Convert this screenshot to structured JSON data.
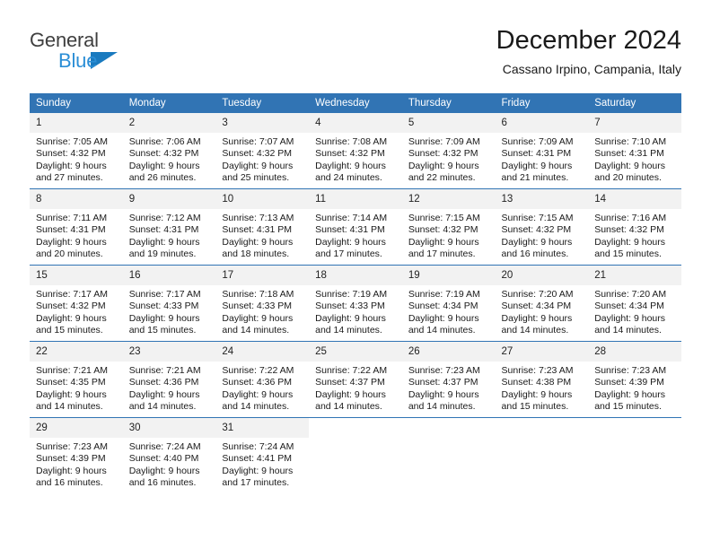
{
  "brand": {
    "name_part1": "General",
    "name_part2": "Blue",
    "triangle_icon": "blue-triangle-logo-mark"
  },
  "header": {
    "title": "December 2024",
    "subtitle": "Cassano Irpino, Campania, Italy"
  },
  "colors": {
    "header_blue": "#3174b4",
    "logo_blue": "#2b8ed6",
    "daynum_band": "#f2f2f2",
    "text": "#1a1a1a"
  },
  "weekday_headers": [
    "Sunday",
    "Monday",
    "Tuesday",
    "Wednesday",
    "Thursday",
    "Friday",
    "Saturday"
  ],
  "labels": {
    "sunrise_prefix": "Sunrise:",
    "sunset_prefix": "Sunset:",
    "daylight_prefix": "Daylight:"
  },
  "weeks": [
    [
      {
        "day": "1",
        "sunrise": "Sunrise: 7:05 AM",
        "sunset": "Sunset: 4:32 PM",
        "daylight1": "Daylight: 9 hours",
        "daylight2": "and 27 minutes."
      },
      {
        "day": "2",
        "sunrise": "Sunrise: 7:06 AM",
        "sunset": "Sunset: 4:32 PM",
        "daylight1": "Daylight: 9 hours",
        "daylight2": "and 26 minutes."
      },
      {
        "day": "3",
        "sunrise": "Sunrise: 7:07 AM",
        "sunset": "Sunset: 4:32 PM",
        "daylight1": "Daylight: 9 hours",
        "daylight2": "and 25 minutes."
      },
      {
        "day": "4",
        "sunrise": "Sunrise: 7:08 AM",
        "sunset": "Sunset: 4:32 PM",
        "daylight1": "Daylight: 9 hours",
        "daylight2": "and 24 minutes."
      },
      {
        "day": "5",
        "sunrise": "Sunrise: 7:09 AM",
        "sunset": "Sunset: 4:32 PM",
        "daylight1": "Daylight: 9 hours",
        "daylight2": "and 22 minutes."
      },
      {
        "day": "6",
        "sunrise": "Sunrise: 7:09 AM",
        "sunset": "Sunset: 4:31 PM",
        "daylight1": "Daylight: 9 hours",
        "daylight2": "and 21 minutes."
      },
      {
        "day": "7",
        "sunrise": "Sunrise: 7:10 AM",
        "sunset": "Sunset: 4:31 PM",
        "daylight1": "Daylight: 9 hours",
        "daylight2": "and 20 minutes."
      }
    ],
    [
      {
        "day": "8",
        "sunrise": "Sunrise: 7:11 AM",
        "sunset": "Sunset: 4:31 PM",
        "daylight1": "Daylight: 9 hours",
        "daylight2": "and 20 minutes."
      },
      {
        "day": "9",
        "sunrise": "Sunrise: 7:12 AM",
        "sunset": "Sunset: 4:31 PM",
        "daylight1": "Daylight: 9 hours",
        "daylight2": "and 19 minutes."
      },
      {
        "day": "10",
        "sunrise": "Sunrise: 7:13 AM",
        "sunset": "Sunset: 4:31 PM",
        "daylight1": "Daylight: 9 hours",
        "daylight2": "and 18 minutes."
      },
      {
        "day": "11",
        "sunrise": "Sunrise: 7:14 AM",
        "sunset": "Sunset: 4:31 PM",
        "daylight1": "Daylight: 9 hours",
        "daylight2": "and 17 minutes."
      },
      {
        "day": "12",
        "sunrise": "Sunrise: 7:15 AM",
        "sunset": "Sunset: 4:32 PM",
        "daylight1": "Daylight: 9 hours",
        "daylight2": "and 17 minutes."
      },
      {
        "day": "13",
        "sunrise": "Sunrise: 7:15 AM",
        "sunset": "Sunset: 4:32 PM",
        "daylight1": "Daylight: 9 hours",
        "daylight2": "and 16 minutes."
      },
      {
        "day": "14",
        "sunrise": "Sunrise: 7:16 AM",
        "sunset": "Sunset: 4:32 PM",
        "daylight1": "Daylight: 9 hours",
        "daylight2": "and 15 minutes."
      }
    ],
    [
      {
        "day": "15",
        "sunrise": "Sunrise: 7:17 AM",
        "sunset": "Sunset: 4:32 PM",
        "daylight1": "Daylight: 9 hours",
        "daylight2": "and 15 minutes."
      },
      {
        "day": "16",
        "sunrise": "Sunrise: 7:17 AM",
        "sunset": "Sunset: 4:33 PM",
        "daylight1": "Daylight: 9 hours",
        "daylight2": "and 15 minutes."
      },
      {
        "day": "17",
        "sunrise": "Sunrise: 7:18 AM",
        "sunset": "Sunset: 4:33 PM",
        "daylight1": "Daylight: 9 hours",
        "daylight2": "and 14 minutes."
      },
      {
        "day": "18",
        "sunrise": "Sunrise: 7:19 AM",
        "sunset": "Sunset: 4:33 PM",
        "daylight1": "Daylight: 9 hours",
        "daylight2": "and 14 minutes."
      },
      {
        "day": "19",
        "sunrise": "Sunrise: 7:19 AM",
        "sunset": "Sunset: 4:34 PM",
        "daylight1": "Daylight: 9 hours",
        "daylight2": "and 14 minutes."
      },
      {
        "day": "20",
        "sunrise": "Sunrise: 7:20 AM",
        "sunset": "Sunset: 4:34 PM",
        "daylight1": "Daylight: 9 hours",
        "daylight2": "and 14 minutes."
      },
      {
        "day": "21",
        "sunrise": "Sunrise: 7:20 AM",
        "sunset": "Sunset: 4:34 PM",
        "daylight1": "Daylight: 9 hours",
        "daylight2": "and 14 minutes."
      }
    ],
    [
      {
        "day": "22",
        "sunrise": "Sunrise: 7:21 AM",
        "sunset": "Sunset: 4:35 PM",
        "daylight1": "Daylight: 9 hours",
        "daylight2": "and 14 minutes."
      },
      {
        "day": "23",
        "sunrise": "Sunrise: 7:21 AM",
        "sunset": "Sunset: 4:36 PM",
        "daylight1": "Daylight: 9 hours",
        "daylight2": "and 14 minutes."
      },
      {
        "day": "24",
        "sunrise": "Sunrise: 7:22 AM",
        "sunset": "Sunset: 4:36 PM",
        "daylight1": "Daylight: 9 hours",
        "daylight2": "and 14 minutes."
      },
      {
        "day": "25",
        "sunrise": "Sunrise: 7:22 AM",
        "sunset": "Sunset: 4:37 PM",
        "daylight1": "Daylight: 9 hours",
        "daylight2": "and 14 minutes."
      },
      {
        "day": "26",
        "sunrise": "Sunrise: 7:23 AM",
        "sunset": "Sunset: 4:37 PM",
        "daylight1": "Daylight: 9 hours",
        "daylight2": "and 14 minutes."
      },
      {
        "day": "27",
        "sunrise": "Sunrise: 7:23 AM",
        "sunset": "Sunset: 4:38 PM",
        "daylight1": "Daylight: 9 hours",
        "daylight2": "and 15 minutes."
      },
      {
        "day": "28",
        "sunrise": "Sunrise: 7:23 AM",
        "sunset": "Sunset: 4:39 PM",
        "daylight1": "Daylight: 9 hours",
        "daylight2": "and 15 minutes."
      }
    ],
    [
      {
        "day": "29",
        "sunrise": "Sunrise: 7:23 AM",
        "sunset": "Sunset: 4:39 PM",
        "daylight1": "Daylight: 9 hours",
        "daylight2": "and 16 minutes."
      },
      {
        "day": "30",
        "sunrise": "Sunrise: 7:24 AM",
        "sunset": "Sunset: 4:40 PM",
        "daylight1": "Daylight: 9 hours",
        "daylight2": "and 16 minutes."
      },
      {
        "day": "31",
        "sunrise": "Sunrise: 7:24 AM",
        "sunset": "Sunset: 4:41 PM",
        "daylight1": "Daylight: 9 hours",
        "daylight2": "and 17 minutes."
      },
      {
        "day": "",
        "sunrise": "",
        "sunset": "",
        "daylight1": "",
        "daylight2": ""
      },
      {
        "day": "",
        "sunrise": "",
        "sunset": "",
        "daylight1": "",
        "daylight2": ""
      },
      {
        "day": "",
        "sunrise": "",
        "sunset": "",
        "daylight1": "",
        "daylight2": ""
      },
      {
        "day": "",
        "sunrise": "",
        "sunset": "",
        "daylight1": "",
        "daylight2": ""
      }
    ]
  ]
}
